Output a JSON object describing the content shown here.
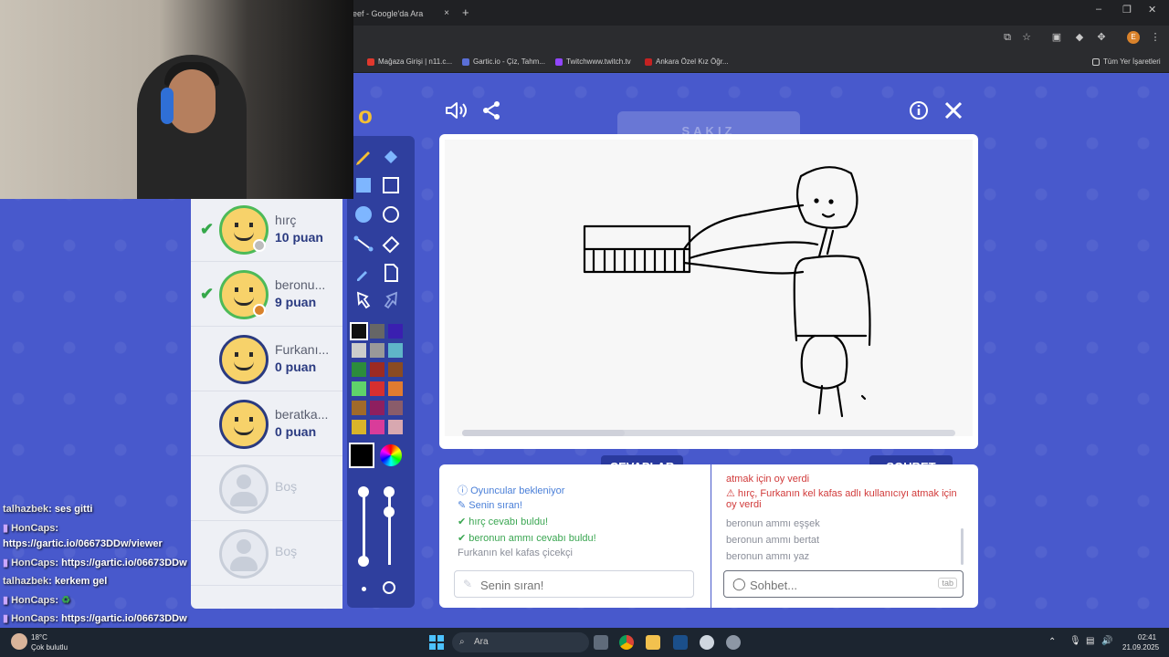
{
  "browser": {
    "tab_title": "eef - Google'da Ara",
    "tab_close": "×",
    "new_tab": "+",
    "window_controls": {
      "minimize": "–",
      "maximize": "❐",
      "close": "✕"
    },
    "profile_initial": "E",
    "bookmarks": [
      {
        "label": "Mağaza Girişi | n11.c...",
        "color": "#e0382d"
      },
      {
        "label": "Gartic.io - Çiz, Tahm...",
        "color": "#5a6fd6"
      },
      {
        "label": "Twitchwww.twitch.tv",
        "color": "#9146ff"
      },
      {
        "label": "Ankara Özel Kız Öğr...",
        "color": "#c42222"
      }
    ],
    "all_bookmarks": "Tüm Yer İşaretleri"
  },
  "game": {
    "logo_fragment": "o",
    "word_hint": "SAKIZ",
    "icons": {
      "sound": "sound-icon",
      "share": "share-icon",
      "info": "info-icon",
      "close": "close-icon"
    },
    "players": [
      {
        "name": "hırç",
        "score": "10 puan",
        "guessed": true,
        "dot": "#bcbcbc"
      },
      {
        "name": "beronu...",
        "score": "9 puan",
        "guessed": true,
        "dot": "#d9822b"
      },
      {
        "name": "Furkanı...",
        "score": "0 puan",
        "guessed": false,
        "dot": ""
      },
      {
        "name": "beratka...",
        "score": "0 puan",
        "guessed": false,
        "dot": ""
      }
    ],
    "empty_slots": [
      "Boş",
      "Boş"
    ],
    "colors": [
      "#111111",
      "#666666",
      "#3a1fb0",
      "#cccccc",
      "#999999",
      "#5fb5c8",
      "#2c8c3c",
      "#9c2a22",
      "#8a4b22",
      "#5fd36a",
      "#d62f2f",
      "#e07b30",
      "#a06a2a",
      "#8e1f5f",
      "#8a5c6a",
      "#d9b42a",
      "#d93c9a",
      "#d8a8b0"
    ],
    "current_color": "#000000",
    "timer_progress": 0.33,
    "tabs": {
      "answers": "CEVAPLAR",
      "chat": "SOHBET"
    },
    "answers": [
      {
        "text": "Oyuncular bekleniyor",
        "type": "info"
      },
      {
        "text": "Senin sıran!",
        "type": "info"
      },
      {
        "text": "hırç cevabı buldu!",
        "type": "success"
      },
      {
        "text": "beronun ammı cevabı buldu!",
        "type": "success"
      },
      {
        "text": "Furkanın kel kafas çicekçi",
        "type": "plain"
      }
    ],
    "answer_placeholder": "Senin sıran!",
    "chat_messages": [
      {
        "text": "atmak için oy verdi",
        "type": "alert"
      },
      {
        "text": "hırç, Furkanın kel kafas adlı kullanıcıyı atmak için oy verdi",
        "type": "alert"
      },
      {
        "text": "beronun ammı eşşek",
        "type": "plain"
      },
      {
        "text": "beronun ammı bertat",
        "type": "plain"
      },
      {
        "text": "beronun ammı yaz",
        "type": "plain"
      }
    ],
    "chat_placeholder": "Sohbet...",
    "chat_tab_hint": "tab"
  },
  "stream_chat": [
    {
      "user": "talhazbek",
      "msg": ": ses gitti"
    },
    {
      "user": "HonCaps",
      "msg": ":"
    },
    {
      "user": "",
      "msg": "https://gartic.io/06673DDw/viewer"
    },
    {
      "user": "HonCaps",
      "msg": ": https://gartic.io/06673DDw"
    },
    {
      "user": "talhazbek",
      "msg": ": kerkem gel"
    },
    {
      "user": "HonCaps",
      "msg": ":"
    },
    {
      "user": "HonCaps",
      "msg": ": https://gartic.io/06673DDw"
    }
  ],
  "taskbar": {
    "weather_temp": "18°C",
    "weather_desc": "Çok bulutlu",
    "search": "Ara",
    "time": "02:41",
    "date": "21.09.2025"
  }
}
